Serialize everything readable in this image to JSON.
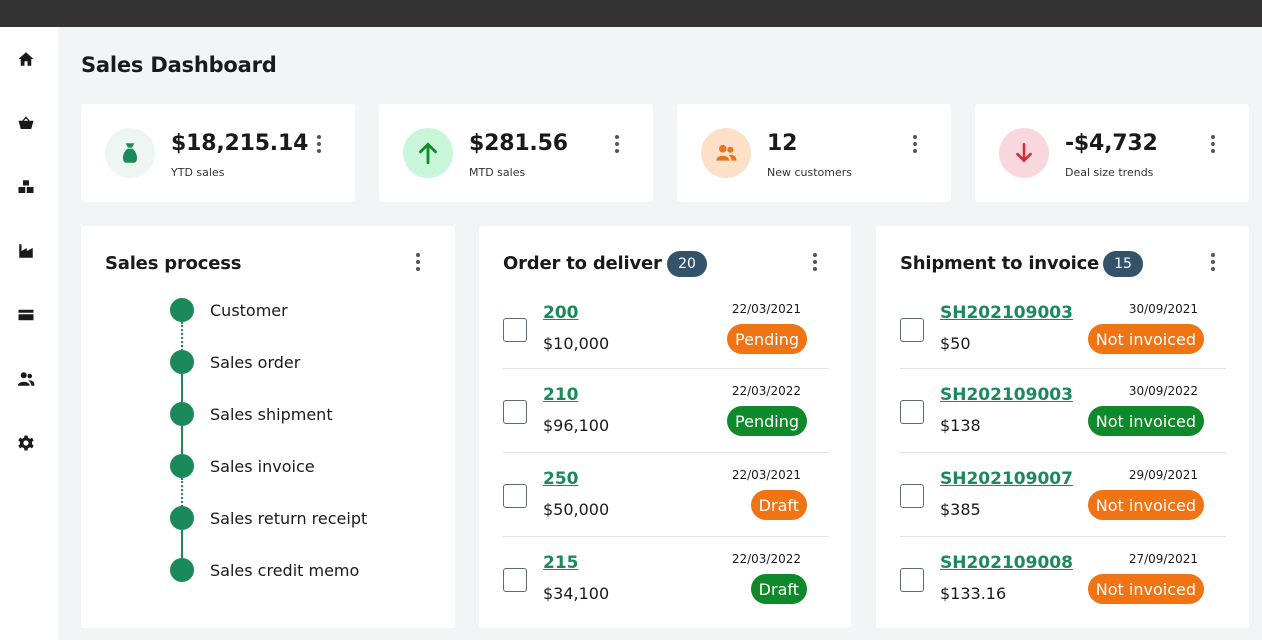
{
  "title": "Sales Dashboard",
  "nav": [
    {
      "icon": "home-icon"
    },
    {
      "icon": "basket-icon"
    },
    {
      "icon": "boxes-icon"
    },
    {
      "icon": "warehouse-icon"
    },
    {
      "icon": "card-icon"
    },
    {
      "icon": "people-icon"
    },
    {
      "icon": "gear-icon"
    }
  ],
  "kpis": [
    {
      "value": "$18,215.14",
      "label": "YTD sales",
      "icon": "money-bag-icon",
      "bg": "#eef6f3",
      "fg": "#1b8a5a"
    },
    {
      "value": "$281.56",
      "label": "MTD sales",
      "icon": "arrow-up-icon",
      "bg": "#c9f5d9",
      "fg": "#0f8a2a"
    },
    {
      "value": "12",
      "label": "New customers",
      "icon": "people-icon",
      "bg": "#fde0c8",
      "fg": "#e8751a"
    },
    {
      "value": "-$4,732",
      "label": "Deal size trends",
      "icon": "arrow-down-icon",
      "bg": "#f8d8dc",
      "fg": "#d42a3a"
    }
  ],
  "sales_process": {
    "title": "Sales process",
    "steps": [
      "Customer",
      "Sales order",
      "Sales shipment",
      "Sales invoice",
      "Sales return receipt",
      "Sales credit memo"
    ]
  },
  "order_to_deliver": {
    "title": "Order to deliver",
    "count": "20",
    "rows": [
      {
        "id": "200",
        "amount": "$10,000",
        "date": "22/03/2021",
        "status": "Pending",
        "color": "orange"
      },
      {
        "id": "210",
        "amount": "$96,100",
        "date": "22/03/2022",
        "status": "Pending",
        "color": "green"
      },
      {
        "id": "250",
        "amount": "$50,000",
        "date": "22/03/2021",
        "status": "Draft",
        "color": "orange"
      },
      {
        "id": "215",
        "amount": "$34,100",
        "date": "22/03/2022",
        "status": "Draft",
        "color": "green"
      }
    ]
  },
  "shipment_to_invoice": {
    "title": "Shipment to invoice",
    "count": "15",
    "rows": [
      {
        "id": "SH202109003",
        "amount": "$50",
        "date": "30/09/2021",
        "status": "Not invoiced",
        "color": "orange"
      },
      {
        "id": "SH202109003",
        "amount": "$138",
        "date": "30/09/2022",
        "status": "Not invoiced",
        "color": "green"
      },
      {
        "id": "SH202109007",
        "amount": "$385",
        "date": "29/09/2021",
        "status": "Not invoiced",
        "color": "orange"
      },
      {
        "id": "SH202109008",
        "amount": "$133.16",
        "date": "27/09/2021",
        "status": "Not invoiced",
        "color": "orange"
      }
    ]
  }
}
